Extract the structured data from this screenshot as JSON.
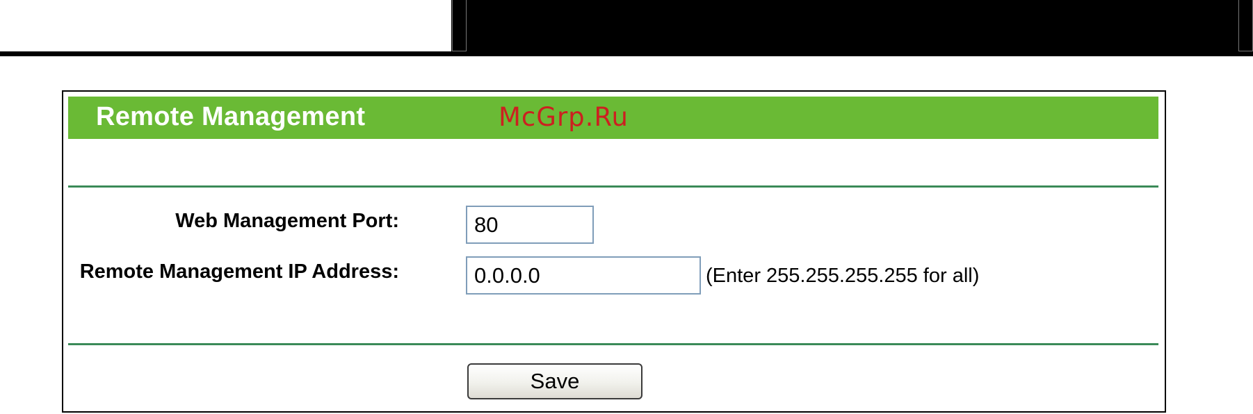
{
  "panel": {
    "title": "Remote Management"
  },
  "fields": {
    "web_port": {
      "label": "Web Management Port:",
      "value": "80"
    },
    "remote_ip": {
      "label": "Remote Management IP Address:",
      "value": "0.0.0.0",
      "hint": "(Enter 255.255.255.255 for all)"
    }
  },
  "actions": {
    "save_label": "Save"
  },
  "watermark": "McGrp.Ru",
  "colors": {
    "header_green": "#6aba35",
    "divider_green": "#3b8a58",
    "input_border": "#7f9db9",
    "watermark_red": "#cc2020"
  }
}
